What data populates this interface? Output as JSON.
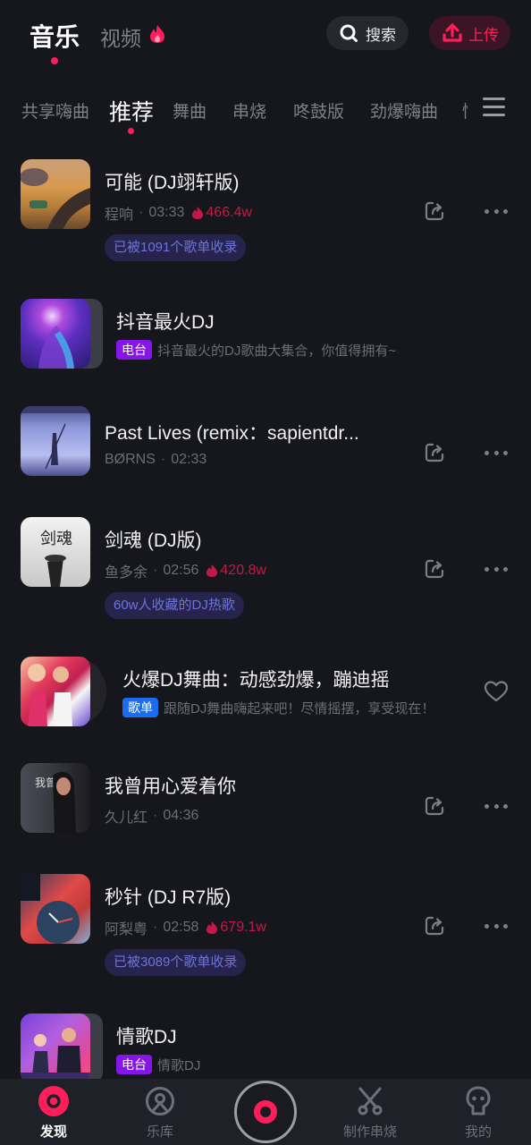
{
  "header": {
    "tabs": [
      {
        "label": "音乐",
        "active": true
      },
      {
        "label": "视频",
        "active": false,
        "icon": "fire-icon"
      }
    ],
    "search_label": "搜索",
    "upload_label": "上传",
    "accent_color": "#ff1e5a"
  },
  "categories": {
    "items": [
      {
        "label": "共享嗨曲",
        "active": false
      },
      {
        "label": "推荐",
        "active": true
      },
      {
        "label": "舞曲",
        "active": false
      },
      {
        "label": "串烧",
        "active": false
      },
      {
        "label": "咚鼓版",
        "active": false
      },
      {
        "label": "劲爆嗨曲",
        "active": false
      },
      {
        "label": "情",
        "active": false
      }
    ],
    "menu_icon": "hamburger-menu-icon"
  },
  "list": [
    {
      "type": "song",
      "title": "可能 (DJ翊轩版)",
      "artist": "程响",
      "duration": "03:33",
      "heat": "466.4w",
      "tag": "已被1091个歌单收录"
    },
    {
      "type": "radio",
      "title": "抖音最火DJ",
      "badge": "电台",
      "description": "抖音最火的DJ歌曲大集合，你值得拥有~"
    },
    {
      "type": "song",
      "title": "Past Lives (remix：sapientdr...",
      "artist": "BØRNS",
      "duration": "02:33"
    },
    {
      "type": "song",
      "title": "剑魂 (DJ版)",
      "artist": "鱼多余",
      "duration": "02:56",
      "heat": "420.8w",
      "tag": "60w人收藏的DJ热歌"
    },
    {
      "type": "playlist",
      "title": "火爆DJ舞曲：动感劲爆，蹦迪摇",
      "badge": "歌单",
      "description": "跟随DJ舞曲嗨起来吧！尽情摇摆，享受现在！"
    },
    {
      "type": "song",
      "title": "我曾用心爱着你",
      "artist": "久儿红",
      "duration": "04:36"
    },
    {
      "type": "song",
      "title": "秒针 (DJ R7版)",
      "artist": "阿梨粤",
      "duration": "02:58",
      "heat": "679.1w",
      "tag": "已被3089个歌单收录"
    },
    {
      "type": "radio",
      "title": "情歌DJ",
      "badge": "电台",
      "description": "情歌DJ"
    }
  ],
  "bottom_nav": {
    "items": [
      {
        "label": "发现",
        "icon": "discover-icon",
        "active": true
      },
      {
        "label": "乐库",
        "icon": "library-icon",
        "active": false
      },
      {
        "label": "",
        "icon": "now-playing-disc-icon",
        "active": false
      },
      {
        "label": "制作串烧",
        "icon": "scissors-icon",
        "active": false
      },
      {
        "label": "我的",
        "icon": "profile-icon",
        "active": false
      }
    ]
  }
}
